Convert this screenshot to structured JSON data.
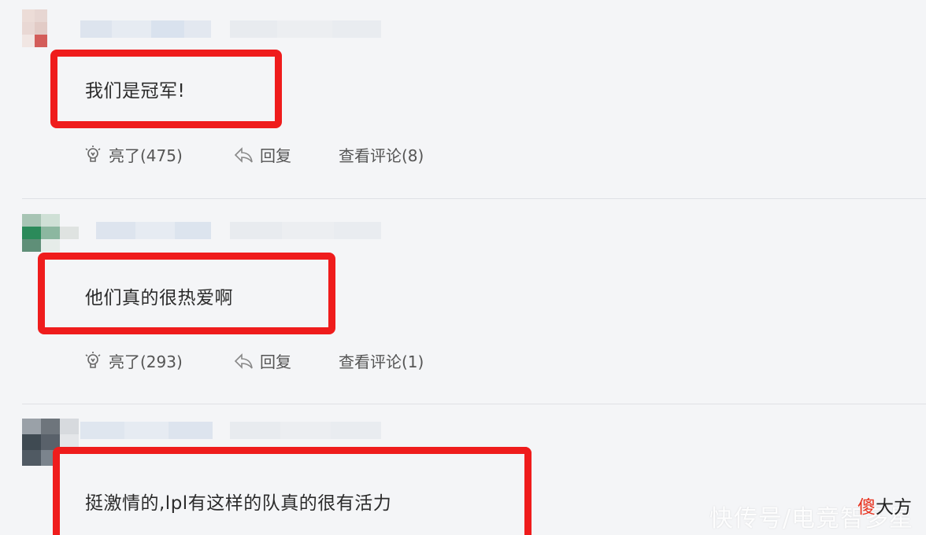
{
  "comments": [
    {
      "text": "我们是冠军!",
      "like_label": "亮了(475)",
      "reply_label": "回复",
      "view_comments_label": "查看评论(8)"
    },
    {
      "text": "他们真的很热爱啊",
      "like_label": "亮了(293)",
      "reply_label": "回复",
      "view_comments_label": "查看评论(1)"
    },
    {
      "text": "挺激情的,lpl有这样的队真的很有活力"
    }
  ],
  "watermark": {
    "text": "快传号/电竞智多星"
  },
  "brand": {
    "first_char": "傻",
    "rest": "大方"
  },
  "colors": {
    "highlight_box": "#ef1c1c",
    "background": "#f4f5f7"
  },
  "icons": {
    "like": "lightbulb-icon",
    "reply": "reply-arrow-icon"
  }
}
